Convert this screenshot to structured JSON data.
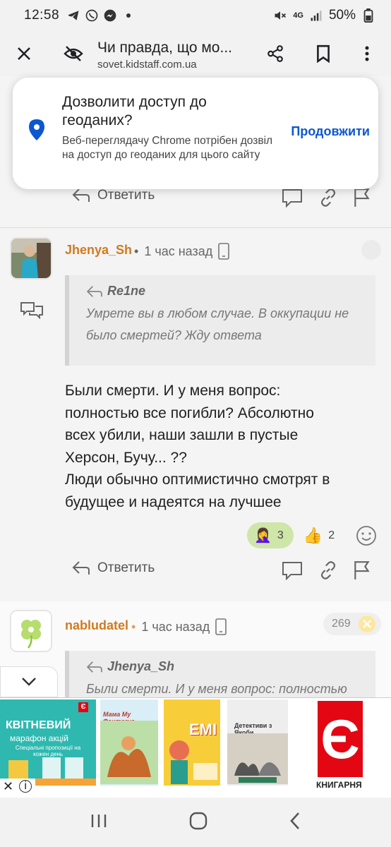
{
  "status_bar": {
    "time": "12:58",
    "battery": "50%",
    "network": "4G"
  },
  "tab_bar": {
    "title": "Чи правда, що мо...",
    "url": "sovet.kidstaff.com.ua"
  },
  "permission_prompt": {
    "title": "Дозволити доступ до геоданих?",
    "description": "Веб-переглядачу Chrome потрібен дозвіл на доступ до геоданих для цього сайту",
    "continue_label": "Продовжити"
  },
  "top_reply": {
    "reply_label": "Ответить"
  },
  "comments": [
    {
      "author": "Jhenya_Sh",
      "time": "1 час назад",
      "quote_author": "Re1ne",
      "quote_text": "Умрете вы в любом случае. В оккупации не было смертей? Жду ответа",
      "text_lines": [
        "Были смерти. И у меня вопрос:",
        "полностью все погибли? Абсолютно",
        "всех убили, наши зашли в пустые",
        "Херсон, Бучу... ??",
        "Люди обычно оптимистично смотрят в",
        "будущее и надеятся на лучшее"
      ],
      "reactions": [
        {
          "emoji": "🤦‍♀️",
          "count": "3"
        },
        {
          "emoji": "👍",
          "count": "2"
        }
      ],
      "reply_label": "Ответить"
    },
    {
      "author": "nabludatel",
      "time": "1 час назад",
      "rating": "269",
      "quote_author": "Jhenya_Sh",
      "quote_text": "Были смерти. И у меня вопрос: полностью"
    }
  ],
  "ad": {
    "tile1_line1": "КВІТНЕВИЙ",
    "tile1_line2": "марафон акцій",
    "tile1_line3": "Спеціальні пропозиції на кожен день",
    "book1": "Мама My Фантазує",
    "book2": "EMI",
    "book3": "Детективи з Якоби",
    "brand": "КНИГАРНЯ",
    "brand_letter": "Є"
  },
  "colors": {
    "author": "#d17a1e",
    "link_blue": "#0b57d0",
    "reaction_pill": "#cfe6a9",
    "brand_red": "#e30613"
  }
}
